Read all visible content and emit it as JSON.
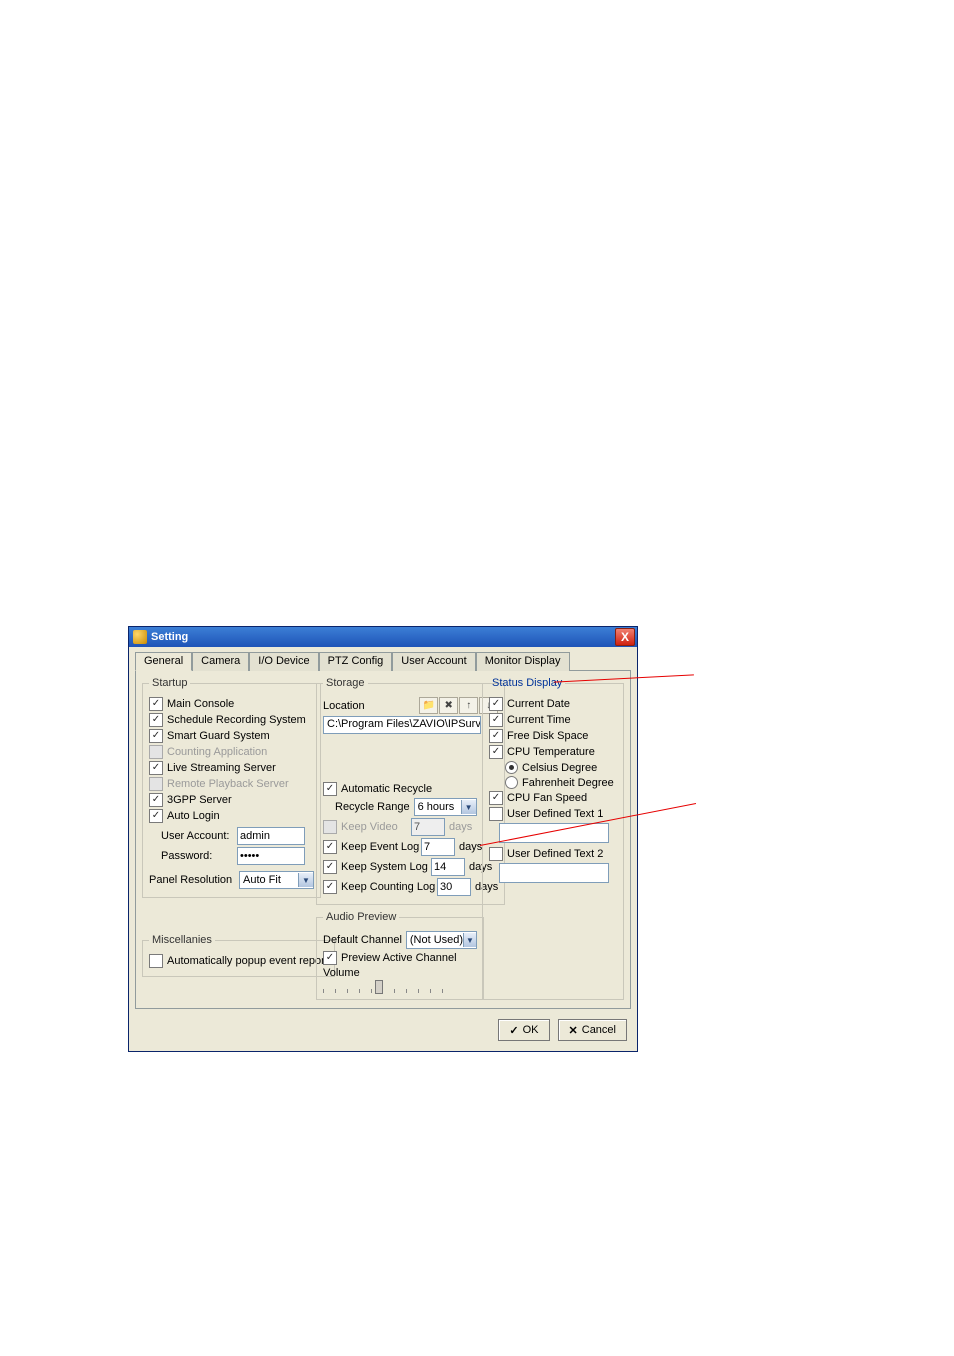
{
  "window": {
    "title": "Setting",
    "close": "X"
  },
  "tabs": [
    "General",
    "Camera",
    "I/O Device",
    "PTZ Config",
    "User Account",
    "Monitor Display"
  ],
  "startup": {
    "legend": "Startup",
    "items": {
      "main_console": "Main Console",
      "schedule_recording": "Schedule Recording System",
      "smart_guard": "Smart Guard System",
      "counting_app": "Counting Application",
      "live_streaming": "Live Streaming Server",
      "remote_playback": "Remote Playback Server",
      "gpp_server": "3GPP Server",
      "auto_login": "Auto Login"
    },
    "user_account_label": "User Account:",
    "user_account_value": "admin",
    "password_label": "Password:",
    "password_value": "*****",
    "panel_res_label": "Panel Resolution",
    "panel_res_value": "Auto Fit"
  },
  "misc": {
    "legend": "Miscellanies",
    "popup_report": "Automatically popup event report"
  },
  "storage": {
    "legend": "Storage",
    "location_label": "Location",
    "location_value": "C:\\Program Files\\ZAVIO\\IPSurve…",
    "auto_recycle": "Automatic Recycle",
    "recycle_range_label": "Recycle Range",
    "recycle_range_value": "6 hours",
    "keep_video": "Keep Video",
    "keep_video_days": "7",
    "keep_event": "Keep Event Log",
    "keep_event_days": "7",
    "keep_system": "Keep System Log",
    "keep_system_days": "14",
    "keep_counting": "Keep Counting Log",
    "keep_counting_days": "30",
    "days": "days"
  },
  "audio": {
    "legend": "Audio Preview",
    "default_channel_label": "Default Channel",
    "default_channel_value": "(Not Used)",
    "preview_active": "Preview Active Channel",
    "volume_label": "Volume"
  },
  "status": {
    "legend": "Status Display",
    "current_date": "Current Date",
    "current_time": "Current Time",
    "free_disk": "Free Disk Space",
    "cpu_temp": "CPU Temperature",
    "celsius": "Celsius Degree",
    "fahrenheit": "Fahrenheit Degree",
    "cpu_fan": "CPU Fan Speed",
    "udt1": "User Defined Text 1",
    "udt2": "User Defined Text 2"
  },
  "buttons": {
    "ok": "OK",
    "cancel": "Cancel"
  }
}
